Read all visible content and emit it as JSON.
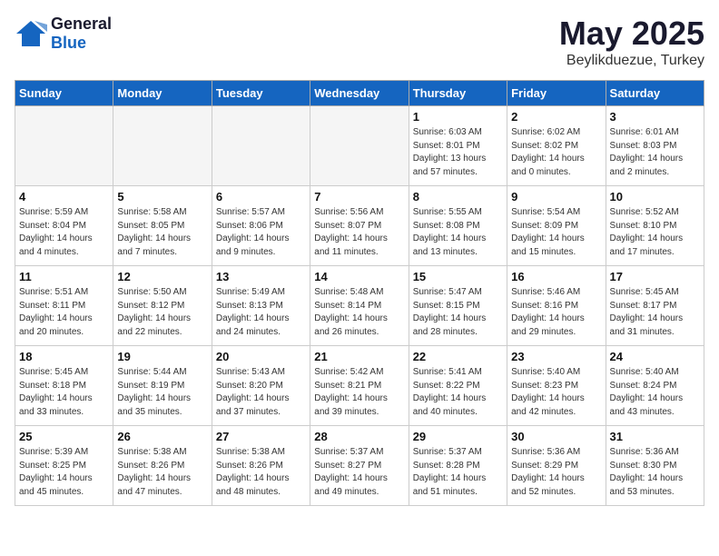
{
  "header": {
    "logo_general": "General",
    "logo_blue": "Blue",
    "title": "May 2025",
    "location": "Beylikduezue, Turkey"
  },
  "days_header": [
    "Sunday",
    "Monday",
    "Tuesday",
    "Wednesday",
    "Thursday",
    "Friday",
    "Saturday"
  ],
  "weeks": [
    [
      {
        "num": "",
        "info": ""
      },
      {
        "num": "",
        "info": ""
      },
      {
        "num": "",
        "info": ""
      },
      {
        "num": "",
        "info": ""
      },
      {
        "num": "1",
        "info": "Sunrise: 6:03 AM\nSunset: 8:01 PM\nDaylight: 13 hours\nand 57 minutes."
      },
      {
        "num": "2",
        "info": "Sunrise: 6:02 AM\nSunset: 8:02 PM\nDaylight: 14 hours\nand 0 minutes."
      },
      {
        "num": "3",
        "info": "Sunrise: 6:01 AM\nSunset: 8:03 PM\nDaylight: 14 hours\nand 2 minutes."
      }
    ],
    [
      {
        "num": "4",
        "info": "Sunrise: 5:59 AM\nSunset: 8:04 PM\nDaylight: 14 hours\nand 4 minutes."
      },
      {
        "num": "5",
        "info": "Sunrise: 5:58 AM\nSunset: 8:05 PM\nDaylight: 14 hours\nand 7 minutes."
      },
      {
        "num": "6",
        "info": "Sunrise: 5:57 AM\nSunset: 8:06 PM\nDaylight: 14 hours\nand 9 minutes."
      },
      {
        "num": "7",
        "info": "Sunrise: 5:56 AM\nSunset: 8:07 PM\nDaylight: 14 hours\nand 11 minutes."
      },
      {
        "num": "8",
        "info": "Sunrise: 5:55 AM\nSunset: 8:08 PM\nDaylight: 14 hours\nand 13 minutes."
      },
      {
        "num": "9",
        "info": "Sunrise: 5:54 AM\nSunset: 8:09 PM\nDaylight: 14 hours\nand 15 minutes."
      },
      {
        "num": "10",
        "info": "Sunrise: 5:52 AM\nSunset: 8:10 PM\nDaylight: 14 hours\nand 17 minutes."
      }
    ],
    [
      {
        "num": "11",
        "info": "Sunrise: 5:51 AM\nSunset: 8:11 PM\nDaylight: 14 hours\nand 20 minutes."
      },
      {
        "num": "12",
        "info": "Sunrise: 5:50 AM\nSunset: 8:12 PM\nDaylight: 14 hours\nand 22 minutes."
      },
      {
        "num": "13",
        "info": "Sunrise: 5:49 AM\nSunset: 8:13 PM\nDaylight: 14 hours\nand 24 minutes."
      },
      {
        "num": "14",
        "info": "Sunrise: 5:48 AM\nSunset: 8:14 PM\nDaylight: 14 hours\nand 26 minutes."
      },
      {
        "num": "15",
        "info": "Sunrise: 5:47 AM\nSunset: 8:15 PM\nDaylight: 14 hours\nand 28 minutes."
      },
      {
        "num": "16",
        "info": "Sunrise: 5:46 AM\nSunset: 8:16 PM\nDaylight: 14 hours\nand 29 minutes."
      },
      {
        "num": "17",
        "info": "Sunrise: 5:45 AM\nSunset: 8:17 PM\nDaylight: 14 hours\nand 31 minutes."
      }
    ],
    [
      {
        "num": "18",
        "info": "Sunrise: 5:45 AM\nSunset: 8:18 PM\nDaylight: 14 hours\nand 33 minutes."
      },
      {
        "num": "19",
        "info": "Sunrise: 5:44 AM\nSunset: 8:19 PM\nDaylight: 14 hours\nand 35 minutes."
      },
      {
        "num": "20",
        "info": "Sunrise: 5:43 AM\nSunset: 8:20 PM\nDaylight: 14 hours\nand 37 minutes."
      },
      {
        "num": "21",
        "info": "Sunrise: 5:42 AM\nSunset: 8:21 PM\nDaylight: 14 hours\nand 39 minutes."
      },
      {
        "num": "22",
        "info": "Sunrise: 5:41 AM\nSunset: 8:22 PM\nDaylight: 14 hours\nand 40 minutes."
      },
      {
        "num": "23",
        "info": "Sunrise: 5:40 AM\nSunset: 8:23 PM\nDaylight: 14 hours\nand 42 minutes."
      },
      {
        "num": "24",
        "info": "Sunrise: 5:40 AM\nSunset: 8:24 PM\nDaylight: 14 hours\nand 43 minutes."
      }
    ],
    [
      {
        "num": "25",
        "info": "Sunrise: 5:39 AM\nSunset: 8:25 PM\nDaylight: 14 hours\nand 45 minutes."
      },
      {
        "num": "26",
        "info": "Sunrise: 5:38 AM\nSunset: 8:26 PM\nDaylight: 14 hours\nand 47 minutes."
      },
      {
        "num": "27",
        "info": "Sunrise: 5:38 AM\nSunset: 8:26 PM\nDaylight: 14 hours\nand 48 minutes."
      },
      {
        "num": "28",
        "info": "Sunrise: 5:37 AM\nSunset: 8:27 PM\nDaylight: 14 hours\nand 49 minutes."
      },
      {
        "num": "29",
        "info": "Sunrise: 5:37 AM\nSunset: 8:28 PM\nDaylight: 14 hours\nand 51 minutes."
      },
      {
        "num": "30",
        "info": "Sunrise: 5:36 AM\nSunset: 8:29 PM\nDaylight: 14 hours\nand 52 minutes."
      },
      {
        "num": "31",
        "info": "Sunrise: 5:36 AM\nSunset: 8:30 PM\nDaylight: 14 hours\nand 53 minutes."
      }
    ]
  ]
}
